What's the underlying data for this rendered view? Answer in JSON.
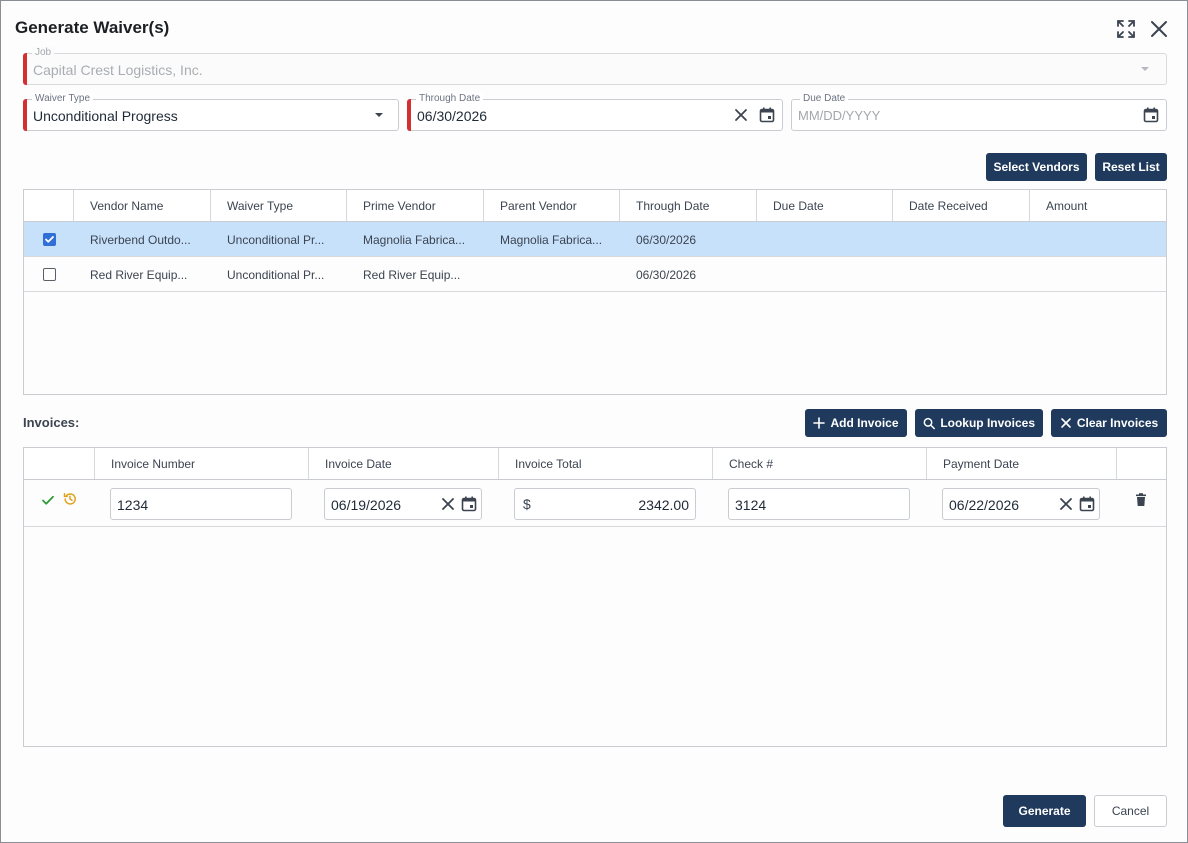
{
  "dialog": {
    "title": "Generate Waiver(s)",
    "icons": {
      "expand": "expand-icon",
      "close": "close-icon"
    }
  },
  "form": {
    "job": {
      "label": "Job",
      "value": "Capital Crest Logistics, Inc."
    },
    "waiver_type": {
      "label": "Waiver Type",
      "value": "Unconditional Progress"
    },
    "through_date": {
      "label": "Through Date",
      "value": "06/30/2026"
    },
    "due_date": {
      "label": "Due Date",
      "placeholder": "MM/DD/YYYY"
    }
  },
  "vendor_actions": {
    "select_vendors": "Select Vendors",
    "reset_list": "Reset List"
  },
  "vendor_table": {
    "columns": [
      "Vendor Name",
      "Waiver Type",
      "Prime Vendor",
      "Parent Vendor",
      "Through Date",
      "Due Date",
      "Date Received",
      "Amount"
    ],
    "rows": [
      {
        "checked": true,
        "vendor_name": "Riverbend Outdo...",
        "waiver_type": "Unconditional Pr...",
        "prime_vendor": "Magnolia Fabrica...",
        "parent_vendor": "Magnolia Fabrica...",
        "through_date": "06/30/2026",
        "due_date": "",
        "date_received": "",
        "amount": ""
      },
      {
        "checked": false,
        "vendor_name": "Red River Equip...",
        "waiver_type": "Unconditional Pr...",
        "prime_vendor": "Red River Equip...",
        "parent_vendor": "",
        "through_date": "06/30/2026",
        "due_date": "",
        "date_received": "",
        "amount": ""
      }
    ]
  },
  "invoices": {
    "label": "Invoices:",
    "actions": {
      "add": "Add Invoice",
      "lookup": "Lookup Invoices",
      "clear": "Clear Invoices"
    },
    "columns": [
      "Invoice Number",
      "Invoice Date",
      "Invoice Total",
      "Check #",
      "Payment Date"
    ],
    "rows": [
      {
        "invoice_number": "1234",
        "invoice_date": "06/19/2026",
        "currency": "$",
        "invoice_total": "2342.00",
        "check_number": "3124",
        "payment_date": "06/22/2026"
      }
    ]
  },
  "footer": {
    "generate": "Generate",
    "cancel": "Cancel"
  },
  "colors": {
    "primary": "#1f3a5c",
    "required": "#d62f2f",
    "selected_row": "#c7e1fb",
    "valid": "#2e9b3a",
    "history": "#e0a21b"
  }
}
